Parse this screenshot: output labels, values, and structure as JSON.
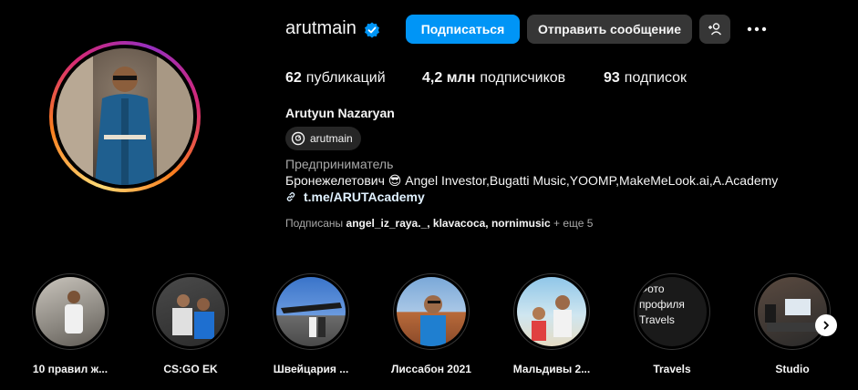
{
  "profile": {
    "username": "arutmain",
    "follow_label": "Подписаться",
    "message_label": "Отправить сообщение",
    "posts_count": "62",
    "posts_label": "публикаций",
    "followers_count": "4,2 млн",
    "followers_label": "подписчиков",
    "following_count": "93",
    "following_label": "подписок",
    "full_name": "Arutyun Nazaryan",
    "threads_handle": "arutmain",
    "category": "Предприниматель",
    "bio": "Бронежелетович 😎 Angel Investor,Bugatti Music,YOOMP,MakeMeLook.ai,A.Academy",
    "link": "t.me/ARUTAcademy",
    "followed_prefix": "Подписаны",
    "followed_by": "angel_iz_raya._, klavacoca, nornimusic",
    "followed_suffix": "+ еще 5"
  },
  "highlights": [
    {
      "label": "10 правил ж..."
    },
    {
      "label": "CS:GO EK"
    },
    {
      "label": "Швейцария ..."
    },
    {
      "label": "Лиссабон 2021"
    },
    {
      "label": "Мальдивы 2..."
    },
    {
      "label": "Travels",
      "alt_text": "Фото профиля Travels"
    },
    {
      "label": "Studio"
    }
  ],
  "colors": {
    "accent": "#0095f6",
    "button_secondary": "#363636",
    "verified": "#0095f6"
  },
  "icons": [
    "verified-badge-icon",
    "add-person-icon",
    "more-options-icon",
    "threads-icon",
    "link-icon",
    "chevron-right-icon"
  ]
}
